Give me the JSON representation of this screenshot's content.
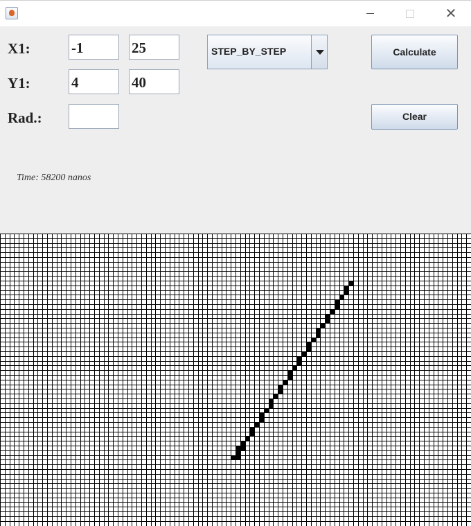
{
  "window": {
    "app_icon": "java-cup-icon",
    "minimize_icon": "minimize-icon",
    "maximize_icon": "maximize-icon",
    "close_icon": "close-icon"
  },
  "form": {
    "x1_label": "X1:",
    "y1_label": "Y1:",
    "rad_label": "Rad.:",
    "x1_value": "-1",
    "x2_value": "25",
    "y1_value": "4",
    "y2_value": "40",
    "radius_value": ""
  },
  "algorithm_select": {
    "selected": "STEP_BY_STEP"
  },
  "buttons": {
    "calculate_label": "Calculate",
    "clear_label": "Clear"
  },
  "status": {
    "time_text": "Time: 58200 nanos"
  },
  "canvas": {
    "grid_color": "#000000",
    "pixel_color": "#000000",
    "background_color": "#ffffff",
    "filled_cells": [
      [
        0,
        0
      ],
      [
        1,
        0
      ],
      [
        1,
        -1
      ],
      [
        1,
        -2
      ],
      [
        2,
        -2
      ],
      [
        2,
        -3
      ],
      [
        3,
        -4
      ],
      [
        4,
        -5
      ],
      [
        4,
        -6
      ],
      [
        5,
        -7
      ],
      [
        6,
        -8
      ],
      [
        6,
        -9
      ],
      [
        7,
        -10
      ],
      [
        8,
        -11
      ],
      [
        8,
        -12
      ],
      [
        9,
        -13
      ],
      [
        10,
        -14
      ],
      [
        10,
        -15
      ],
      [
        11,
        -16
      ],
      [
        12,
        -17
      ],
      [
        12,
        -18
      ],
      [
        13,
        -19
      ],
      [
        14,
        -20
      ],
      [
        14,
        -21
      ],
      [
        15,
        -22
      ],
      [
        16,
        -23
      ],
      [
        16,
        -24
      ],
      [
        17,
        -25
      ],
      [
        18,
        -26
      ],
      [
        18,
        -27
      ],
      [
        19,
        -28
      ],
      [
        20,
        -29
      ],
      [
        20,
        -30
      ],
      [
        21,
        -31
      ],
      [
        22,
        -32
      ],
      [
        22,
        -33
      ],
      [
        23,
        -34
      ],
      [
        24,
        -35
      ],
      [
        24,
        -36
      ],
      [
        25,
        -37
      ]
    ]
  }
}
